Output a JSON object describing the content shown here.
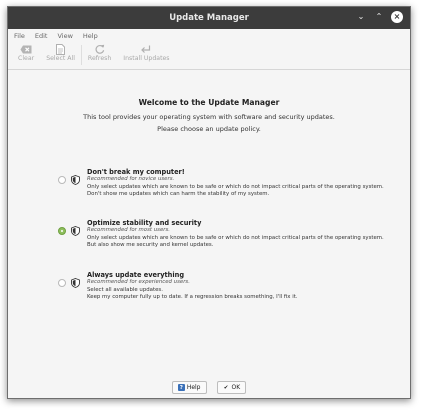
{
  "window": {
    "title": "Update Manager"
  },
  "menu": [
    "File",
    "Edit",
    "View",
    "Help"
  ],
  "toolbar": {
    "clear": "Clear",
    "select_all": "Select All",
    "refresh": "Refresh",
    "install": "Install Updates"
  },
  "intro": {
    "heading": "Welcome to the Update Manager",
    "line1": "This tool provides your operating system with software and security updates.",
    "line2": "Please choose an update policy."
  },
  "options": [
    {
      "title": "Don't break my computer!",
      "recommended": "Recommended for novice users.",
      "desc1": "Only select updates which are known to be safe or which do not impact critical parts of the operating system.",
      "desc2": "Don't show me updates which can harm the stability of my system.",
      "selected": false
    },
    {
      "title": "Optimize stability and security",
      "recommended": "Recommended for most users.",
      "desc1": "Only select updates which are known to be safe or which do not impact critical parts of the operating system.",
      "desc2": "But also show me security and kernel updates.",
      "selected": true
    },
    {
      "title": "Always update everything",
      "recommended": "Recommended for experienced users.",
      "desc1": "Select all available updates.",
      "desc2": "Keep my computer fully up to date. If a regression breaks something, I'll fix it.",
      "selected": false
    }
  ],
  "buttons": {
    "help": "Help",
    "ok": "OK"
  },
  "colors": {
    "titlebar": "#3c3c3c",
    "accent": "#8fbf5e"
  }
}
